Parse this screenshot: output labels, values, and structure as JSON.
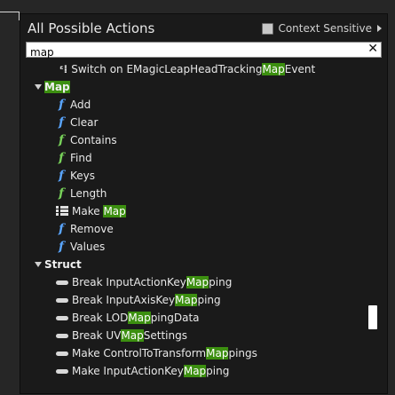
{
  "header": {
    "title": "All Possible Actions",
    "context_sensitive_label": "Context Sensitive"
  },
  "search": {
    "value": "map",
    "clear_icon": "close-icon"
  },
  "items": {
    "event": {
      "pre": "Switch on EMagicLeapHeadTrackingMapEvent"
    },
    "cat_map": "Map",
    "add": "Add",
    "clear": "Clear",
    "contains": "Contains",
    "find": "Find",
    "keys": "Keys",
    "length": "Length",
    "make_pre": "Make ",
    "make_hl": "Map",
    "remove": "Remove",
    "values": "Values",
    "cat_struct": "Struct",
    "b1_pre": "Break InputActionKey",
    "b1_hl": "Map",
    "b1_post": "ping",
    "b2_pre": "Break InputAxisKey",
    "b2_hl": "Map",
    "b2_post": "ping",
    "b3_pre": "Break LOD",
    "b3_hl": "Map",
    "b3_post": "pingData",
    "b4_pre": "Break UV",
    "b4_hl": "Map",
    "b4_post": "Settings",
    "m1_pre": "Make ControlToTransform",
    "m1_hl": "Map",
    "m1_post": "pings",
    "m2_pre": "Make InputActionKey",
    "m2_hl": "Map",
    "m2_post": "ping"
  },
  "colors": {
    "highlight": "#3c8f10",
    "function_blue": "#5aa6ff",
    "function_green": "#78d25a"
  }
}
